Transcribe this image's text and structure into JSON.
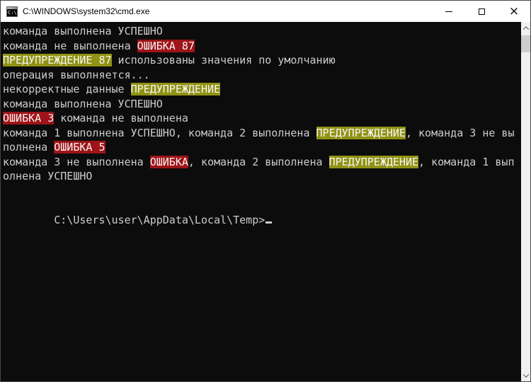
{
  "window": {
    "title": "C:\\WINDOWS\\system32\\cmd.exe",
    "icon_text": "C:\\",
    "controls": {
      "close_glyph": "×"
    }
  },
  "colors": {
    "titlebar_bg": "#ffffff",
    "title_text": "#000000",
    "console_bg": "#0c0c0c",
    "text": "#cccccc",
    "error_bg": "#9e1418",
    "warning_bg": "#909213",
    "highlight_text": "#f5f5f5",
    "scrollbar_track": "#f0f0f0",
    "scrollbar_thumb": "#cdcdcd"
  },
  "terminal": {
    "lines": [
      [
        {
          "t": "команда выполнена УСПЕШНО",
          "s": "n"
        }
      ],
      [
        {
          "t": "команда не выполнена ",
          "s": "n"
        },
        {
          "t": "ОШИБКА 87",
          "s": "e"
        }
      ],
      [
        {
          "t": "ПРЕДУПРЕЖДЕНИЕ 87",
          "s": "w"
        },
        {
          "t": " использованы значения по умолчанию",
          "s": "n"
        }
      ],
      [
        {
          "t": "операция выполняется...",
          "s": "n"
        }
      ],
      [
        {
          "t": "некорректные данные ",
          "s": "n"
        },
        {
          "t": "ПРЕДУПРЕЖДЕНИЕ",
          "s": "w"
        }
      ],
      [
        {
          "t": "команда выполнена УСПЕШНО",
          "s": "n"
        }
      ],
      [
        {
          "t": "ОШИБКА 3",
          "s": "e"
        },
        {
          "t": " команда не выполнена",
          "s": "n"
        }
      ],
      [
        {
          "t": "команда 1 выполнена УСПЕШНО, команда 2 выполнена ",
          "s": "n"
        },
        {
          "t": "ПРЕДУПРЕЖДЕНИЕ",
          "s": "w"
        },
        {
          "t": ", команда 3 не вы",
          "s": "n"
        }
      ],
      [
        {
          "t": "полнена ",
          "s": "n"
        },
        {
          "t": "ОШИБКА 5",
          "s": "e"
        }
      ],
      [
        {
          "t": "команда 3 не выполнена ",
          "s": "n"
        },
        {
          "t": "ОШИБКА",
          "s": "e"
        },
        {
          "t": ", команда 2 выполнена ",
          "s": "n"
        },
        {
          "t": "ПРЕДУПРЕЖДЕНИЕ",
          "s": "w"
        },
        {
          "t": ", команда 1 вып",
          "s": "n"
        }
      ],
      [
        {
          "t": "олнена УСПЕШНО",
          "s": "n"
        }
      ],
      []
    ],
    "prompt": "C:\\Users\\user\\AppData\\Local\\Temp>"
  }
}
